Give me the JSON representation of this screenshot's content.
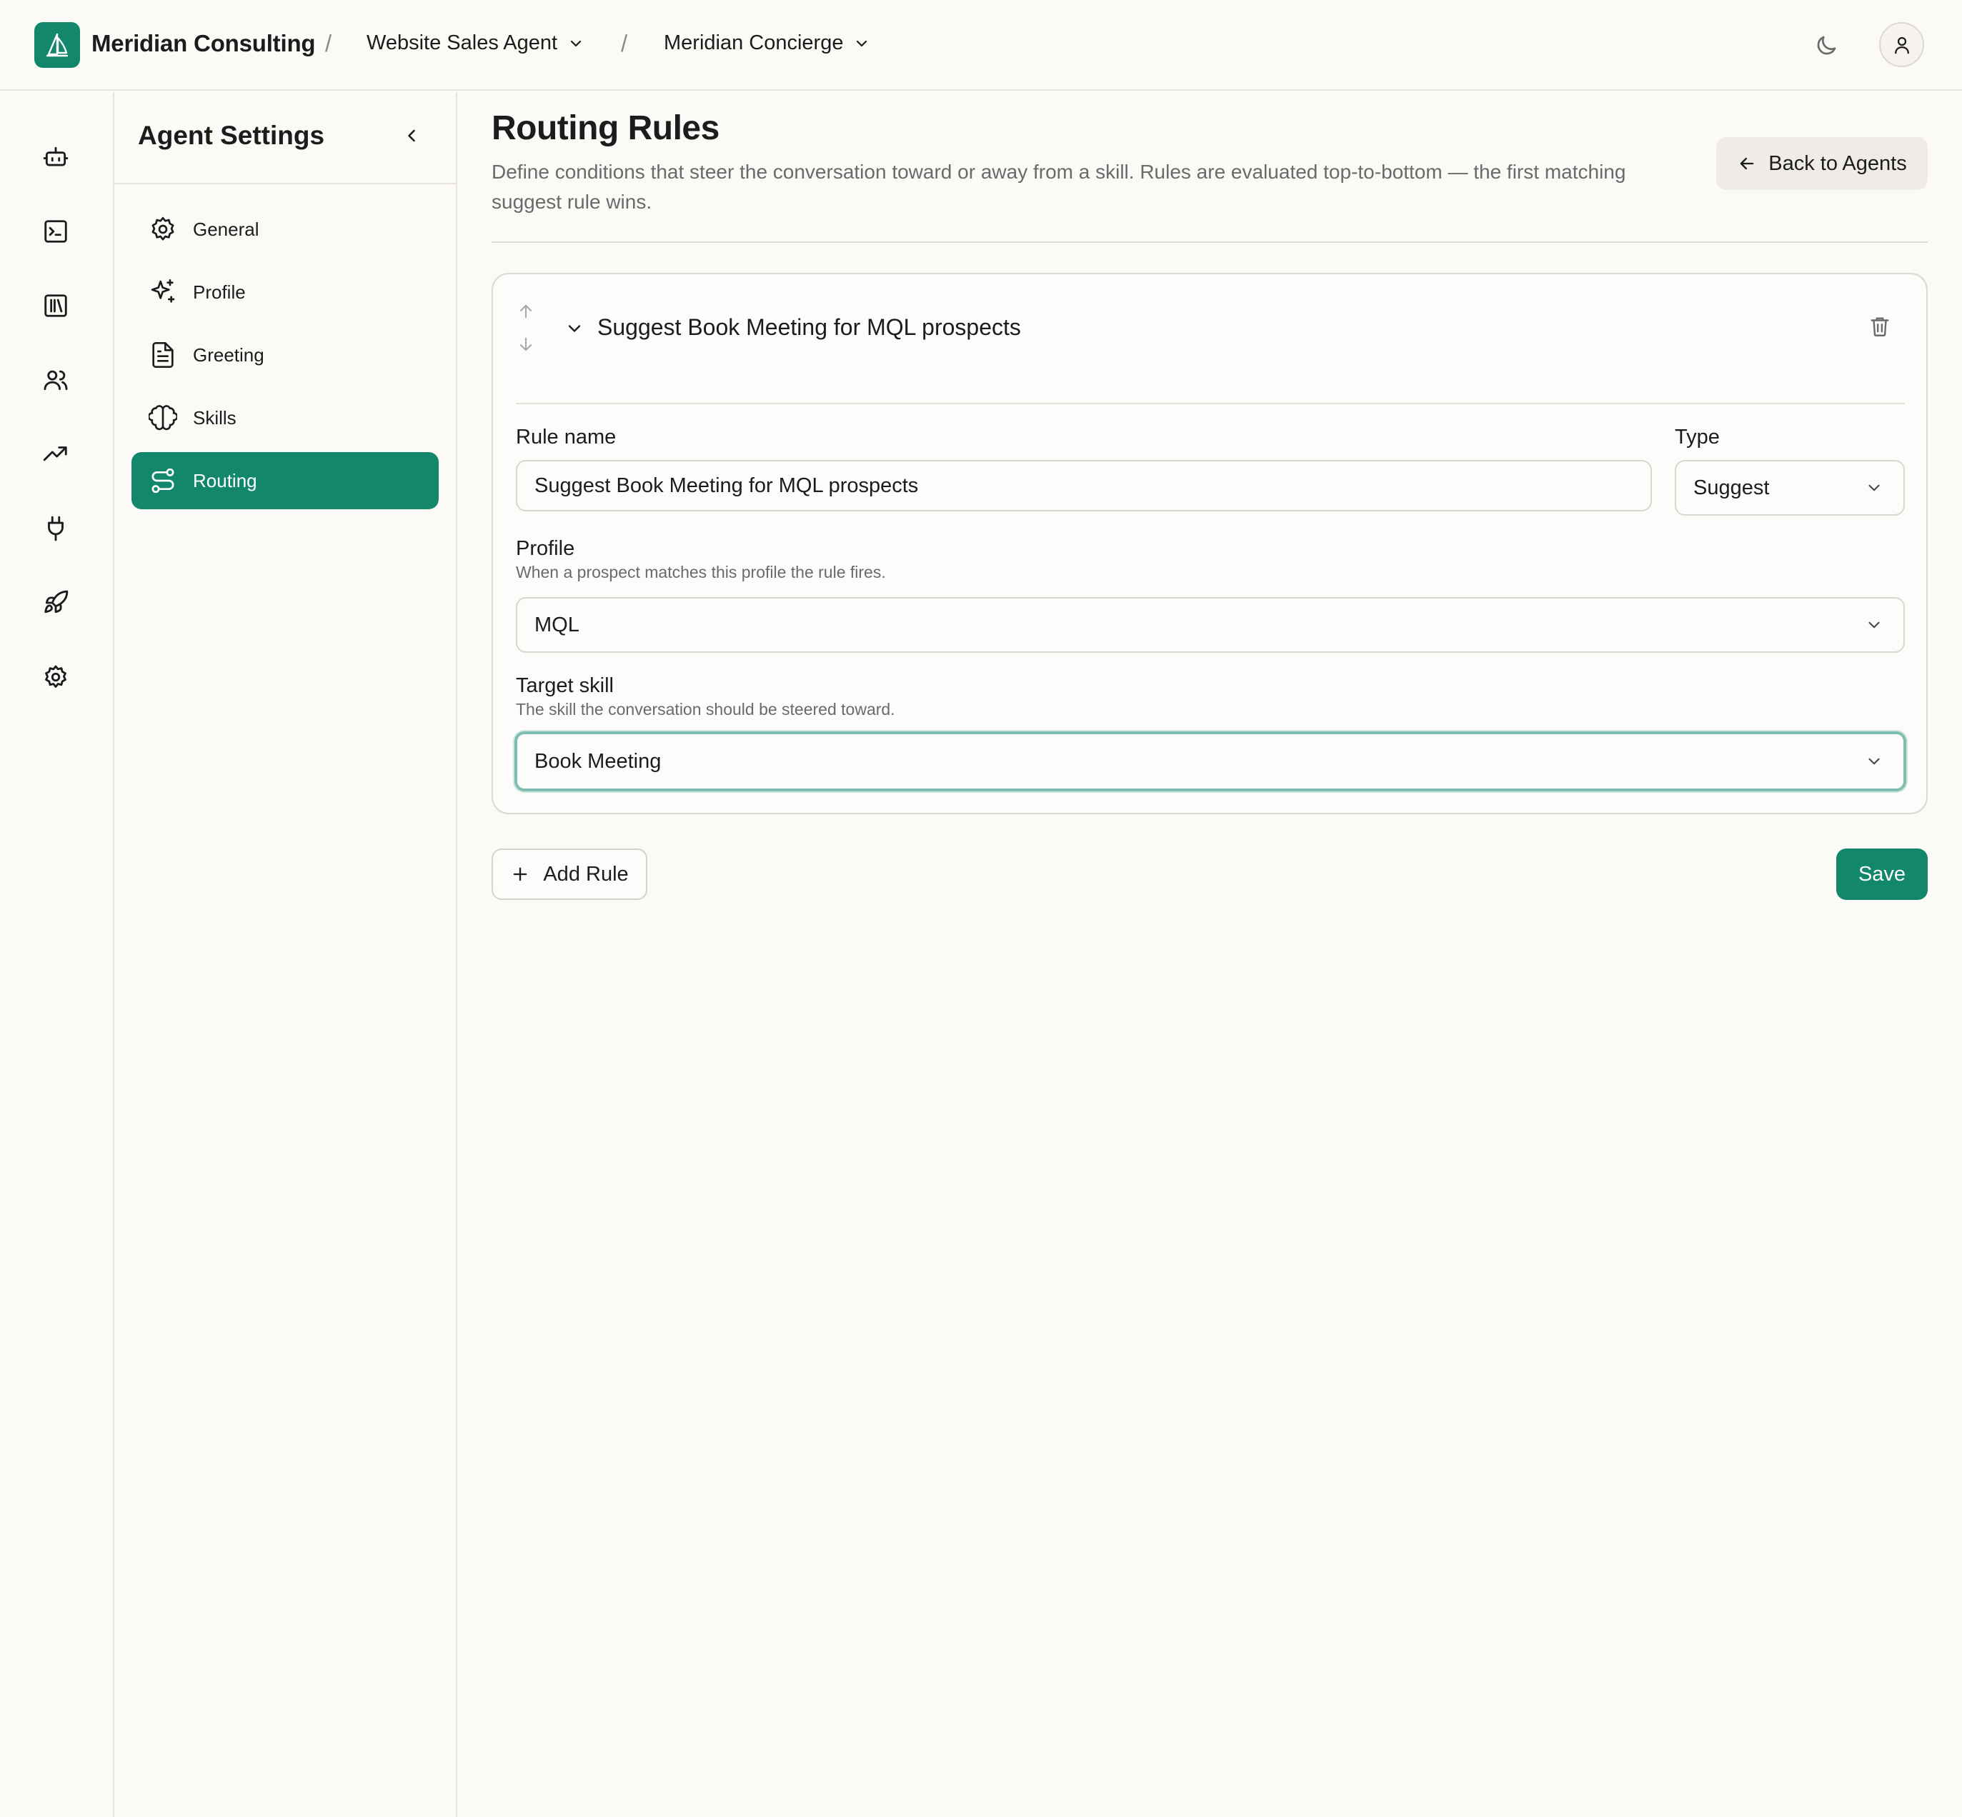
{
  "header": {
    "org_name": "Meridian Consulting",
    "breadcrumb_sep": "/",
    "agent": "Website Sales Agent",
    "persona": "Meridian Concierge"
  },
  "sidebar": {
    "title": "Agent Settings",
    "items": [
      {
        "label": "General",
        "icon": "gear-icon"
      },
      {
        "label": "Profile",
        "icon": "sparkles-icon"
      },
      {
        "label": "Greeting",
        "icon": "document-icon"
      },
      {
        "label": "Skills",
        "icon": "brain-icon"
      },
      {
        "label": "Routing",
        "icon": "route-icon",
        "active": true
      }
    ]
  },
  "rail": [
    "bot-icon",
    "terminal-icon",
    "library-icon",
    "users-icon",
    "trending-up-icon",
    "plug-icon",
    "rocket-icon",
    "settings-icon"
  ],
  "page": {
    "title": "Routing Rules",
    "description": "Define conditions that steer the conversation toward or away from a skill. Rules are evaluated top-to-bottom — the first matching suggest rule wins.",
    "back_label": "Back to Agents"
  },
  "rule": {
    "title": "Suggest Book Meeting for MQL prospects",
    "name_label": "Rule name",
    "name_value": "Suggest Book Meeting for MQL prospects",
    "type_label": "Type",
    "type_value": "Suggest",
    "profile_label": "Profile",
    "profile_hint": "When a prospect matches this profile the rule fires.",
    "profile_value": "MQL",
    "target_label": "Target skill",
    "target_hint": "The skill the conversation should be steered toward.",
    "target_value": "Book Meeting"
  },
  "actions": {
    "add_rule": "Add Rule",
    "save": "Save"
  },
  "colors": {
    "accent": "#12876b",
    "focus_ring": "#7ebdb0",
    "background": "#fcfaf7"
  }
}
